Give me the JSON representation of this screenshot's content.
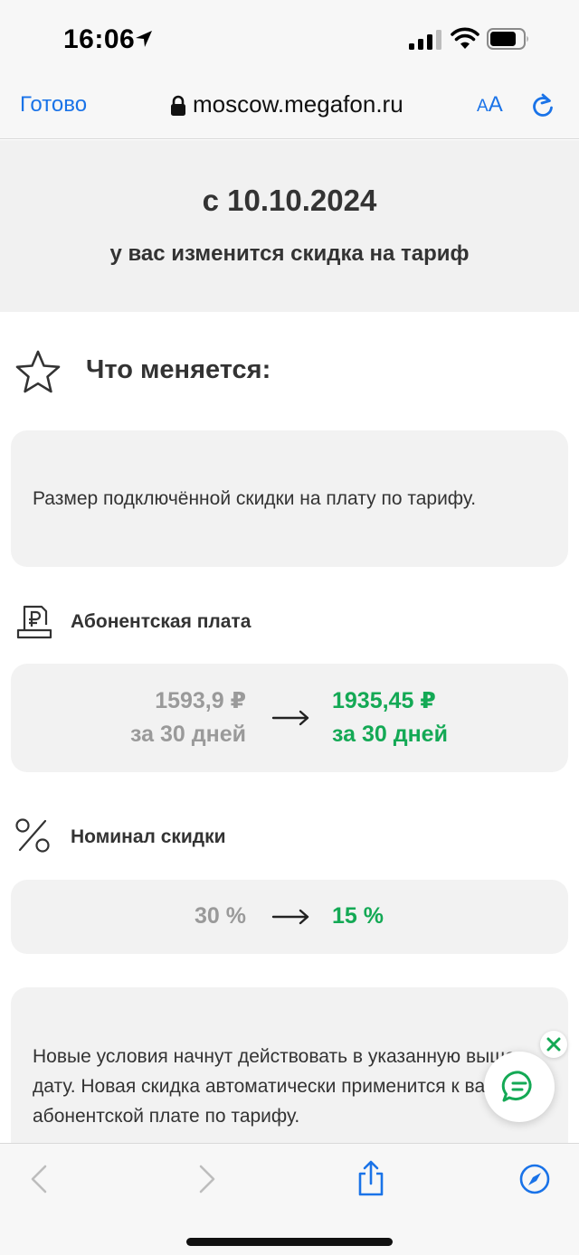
{
  "status_bar": {
    "time": "16:06"
  },
  "browser": {
    "done_label": "Готово",
    "url": "moscow.megafon.ru",
    "text_size_small": "A",
    "text_size_large": "A"
  },
  "banner": {
    "date": "с 10.10.2024",
    "subtitle": "у вас изменится скидка на тариф"
  },
  "changes": {
    "title": "Что меняется:",
    "description": "Размер подключённой скидки на плату по тарифу."
  },
  "subscription_fee": {
    "title": "Абонентская плата",
    "old_amount": "1593,9 ₽",
    "old_period": "за 30 дней",
    "new_amount": "1935,45 ₽",
    "new_period": "за 30 дней"
  },
  "discount": {
    "title": "Номинал скидки",
    "old_value": "30 %",
    "new_value": "15 %"
  },
  "notice": {
    "text": "Новые условия начнут действовать в указанную выше дату. Новая скидка автоматически применится к вашей абонентской плате по тарифу."
  },
  "colors": {
    "accent_blue": "#1a73e8",
    "new_value_green": "#14a955",
    "old_value_gray": "#9a9a9a",
    "card_bg": "#f2f2f2"
  },
  "icons": {
    "location": "location-arrow-icon",
    "signal": "cellular-signal-icon",
    "wifi": "wifi-icon",
    "battery": "battery-icon",
    "lock": "lock-icon",
    "reload": "reload-icon",
    "star": "star-icon",
    "receipt": "ruble-receipt-icon",
    "percent": "percent-icon",
    "arrow": "arrow-right-icon",
    "chat": "chat-icon",
    "close": "close-icon",
    "back": "chevron-left-icon",
    "forward": "chevron-right-icon",
    "share": "share-icon",
    "compass": "compass-icon"
  }
}
